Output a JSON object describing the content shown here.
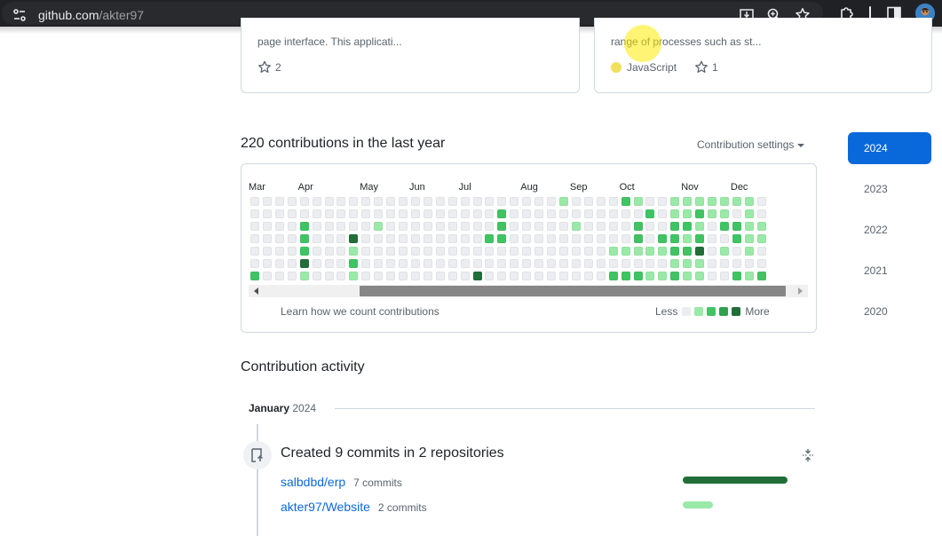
{
  "browser": {
    "url_host": "github.com",
    "url_path": "/akter97",
    "icons": [
      "site-settings-icon",
      "install-app-icon",
      "zoom-icon",
      "bookmark-star-icon",
      "extensions-icon",
      "side-panel-icon",
      "profile-avatar"
    ]
  },
  "repo_cards": [
    {
      "description": "page interface. This applicati...",
      "stars": "2",
      "language": ""
    },
    {
      "description": "range of processes such as st...",
      "stars": "1",
      "language": "JavaScript",
      "language_color": "#f1e05a"
    }
  ],
  "contributions": {
    "title": "220 contributions in the last year",
    "settings_label": "Contribution settings",
    "months": [
      "Mar",
      "Apr",
      "May",
      "Jun",
      "Jul",
      "Aug",
      "Sep",
      "Oct",
      "Nov",
      "Dec"
    ],
    "learn_link": "Learn how we count contributions",
    "legend_less": "Less",
    "legend_more": "More",
    "level_colors": [
      "#ebedf0",
      "#9be9a8",
      "#40c463",
      "#30a14e",
      "#216e39"
    ],
    "scroll_thumb_position": 0.22,
    "grid": [
      "0000000000000000000000000000000000000000000000000000000000000000000000000000000000000000",
      "0000000000000000000000000000000000000000000000000000000000000000000000000000000000000000",
      "0000000000000000000000000000000000000000000000000000000000000000000000000000000000000000",
      "0000000000000000000000000000000000000000000000000000000000000000000000000000000000000000",
      "0000000000000000000000000000000000000000000000000000000000000000000000000000000000000000",
      "0000000000000000000000000000000000000000000000000000000000000000000000000000000000000000",
      "0000000000000000000000000000000000000000000000000000000000000000000000000000000000000000"
    ],
    "weeks": [
      [
        0,
        0,
        0,
        0,
        0,
        0,
        2
      ],
      [
        0,
        0,
        0,
        0,
        0,
        0,
        0
      ],
      [
        0,
        0,
        0,
        0,
        0,
        0,
        0
      ],
      [
        0,
        0,
        0,
        0,
        0,
        0,
        0
      ],
      [
        0,
        0,
        2,
        2,
        2,
        4,
        1
      ],
      [
        0,
        0,
        0,
        0,
        0,
        0,
        0
      ],
      [
        0,
        0,
        0,
        0,
        0,
        0,
        0
      ],
      [
        0,
        0,
        0,
        0,
        0,
        0,
        0
      ],
      [
        0,
        0,
        0,
        4,
        1,
        2,
        1
      ],
      [
        0,
        0,
        0,
        0,
        0,
        0,
        0
      ],
      [
        0,
        0,
        1,
        0,
        0,
        0,
        0
      ],
      [
        0,
        0,
        0,
        0,
        0,
        0,
        0
      ],
      [
        0,
        0,
        0,
        0,
        0,
        0,
        0
      ],
      [
        0,
        0,
        0,
        0,
        0,
        0,
        0
      ],
      [
        0,
        0,
        0,
        0,
        0,
        0,
        0
      ],
      [
        0,
        0,
        0,
        0,
        0,
        0,
        0
      ],
      [
        0,
        0,
        0,
        0,
        0,
        0,
        0
      ],
      [
        0,
        0,
        0,
        0,
        0,
        0,
        0
      ],
      [
        0,
        0,
        0,
        0,
        0,
        0,
        4
      ],
      [
        0,
        0,
        0,
        2,
        0,
        0,
        0
      ],
      [
        0,
        2,
        2,
        2,
        0,
        0,
        0
      ],
      [
        0,
        0,
        0,
        0,
        0,
        0,
        0
      ],
      [
        0,
        0,
        0,
        0,
        0,
        0,
        0
      ],
      [
        0,
        0,
        0,
        0,
        0,
        0,
        0
      ],
      [
        0,
        0,
        0,
        0,
        0,
        0,
        0
      ],
      [
        1,
        0,
        0,
        0,
        0,
        0,
        0
      ],
      [
        0,
        0,
        1,
        0,
        0,
        0,
        0
      ],
      [
        0,
        0,
        0,
        0,
        0,
        0,
        0
      ],
      [
        0,
        0,
        0,
        0,
        0,
        0,
        0
      ],
      [
        0,
        0,
        0,
        0,
        1,
        0,
        2
      ],
      [
        2,
        0,
        0,
        0,
        1,
        0,
        2
      ],
      [
        1,
        0,
        2,
        2,
        1,
        0,
        2
      ],
      [
        0,
        2,
        0,
        0,
        1,
        0,
        1
      ],
      [
        0,
        0,
        0,
        2,
        1,
        0,
        1
      ],
      [
        1,
        1,
        2,
        2,
        2,
        1,
        2
      ],
      [
        1,
        1,
        2,
        1,
        2,
        1,
        1
      ],
      [
        1,
        2,
        1,
        2,
        4,
        1,
        1
      ],
      [
        1,
        1,
        0,
        0,
        0,
        0,
        0
      ],
      [
        1,
        1,
        2,
        0,
        1,
        0,
        0
      ],
      [
        1,
        0,
        2,
        2,
        0,
        0,
        2
      ],
      [
        1,
        1,
        1,
        1,
        1,
        0,
        1
      ],
      [
        0,
        0,
        1,
        1,
        0,
        0,
        2
      ]
    ]
  },
  "years": [
    "2024",
    "2023",
    "2022",
    "2021",
    "2020"
  ],
  "active_year": "2024",
  "activity": {
    "title": "Contribution activity",
    "month": "January",
    "year": "2024",
    "headline": "Created 9 commits in 2 repositories",
    "repos": [
      {
        "name": "salbdbd/erp",
        "commits": "7 commits",
        "share": 1.0,
        "color": "#216e39"
      },
      {
        "name": "akter97/Website",
        "commits": "2 commits",
        "share": 0.29,
        "color": "#9be9a8"
      }
    ]
  }
}
